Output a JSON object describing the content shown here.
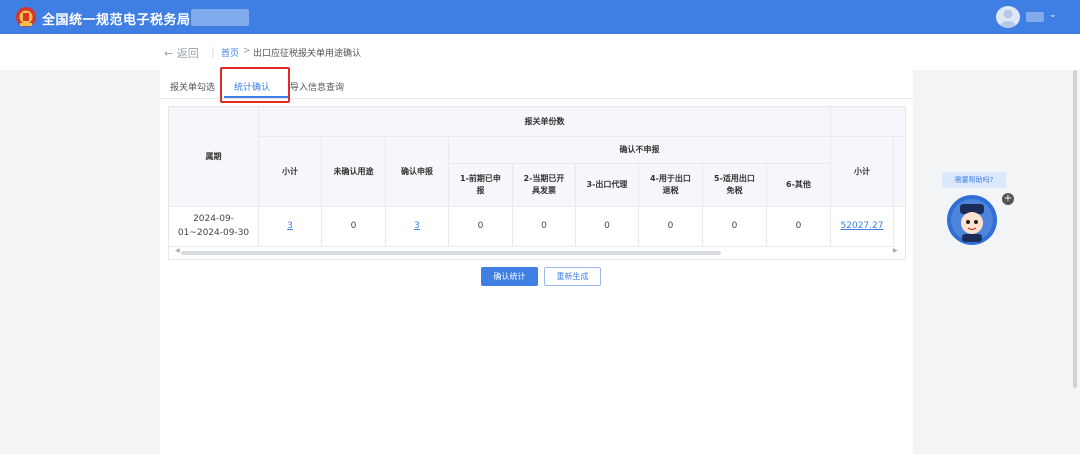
{
  "header": {
    "app_title": "全国统一规范电子税务局"
  },
  "breadcrumb": {
    "back_label": "← 返回",
    "home": "首页",
    "separator": ">",
    "current": "出口应征税报关单用途确认"
  },
  "tabs": [
    {
      "label": "报关单勾选"
    },
    {
      "label": "统计确认",
      "active": true
    },
    {
      "label": "导入信息查询"
    }
  ],
  "table": {
    "period_header": "属期",
    "group_header": "报关单份数",
    "sub_group_header": "确认不申报",
    "columns": {
      "subtotal": "小计",
      "unconfirmed": "未确认用途",
      "confirm_declare": "确认申报",
      "c1_line1": "1-前期已申",
      "c1_line2": "报",
      "c2_line1": "2-当期已开",
      "c2_line2": "具发票",
      "c3": "3-出口代理",
      "c4_line1": "4-用于出口",
      "c4_line2": "退税",
      "c5_line1": "5-适用出口",
      "c5_line2": "免税",
      "c6": "6-其他",
      "subtotal2": "小计"
    },
    "row": {
      "period_line1": "2024-09-",
      "period_line2": "01~2024-09-30",
      "subtotal": "3",
      "unconfirmed": "0",
      "confirm_declare": "3",
      "c1": "0",
      "c2": "0",
      "c3": "0",
      "c4": "0",
      "c5": "0",
      "c6": "0",
      "amount": "52027.27"
    },
    "more_marker": "⋮"
  },
  "actions": {
    "confirm": "确认统计",
    "regenerate": "重新生成"
  },
  "help": {
    "bubble": "需要帮助吗?",
    "badge_text": "+"
  },
  "colors": {
    "primary": "#3f7fe3",
    "highlight": "#e02a2a"
  },
  "icons": [
    "emblem-icon",
    "user-avatar-icon",
    "chevron-down-icon",
    "assistant-icon",
    "plus-icon"
  ]
}
